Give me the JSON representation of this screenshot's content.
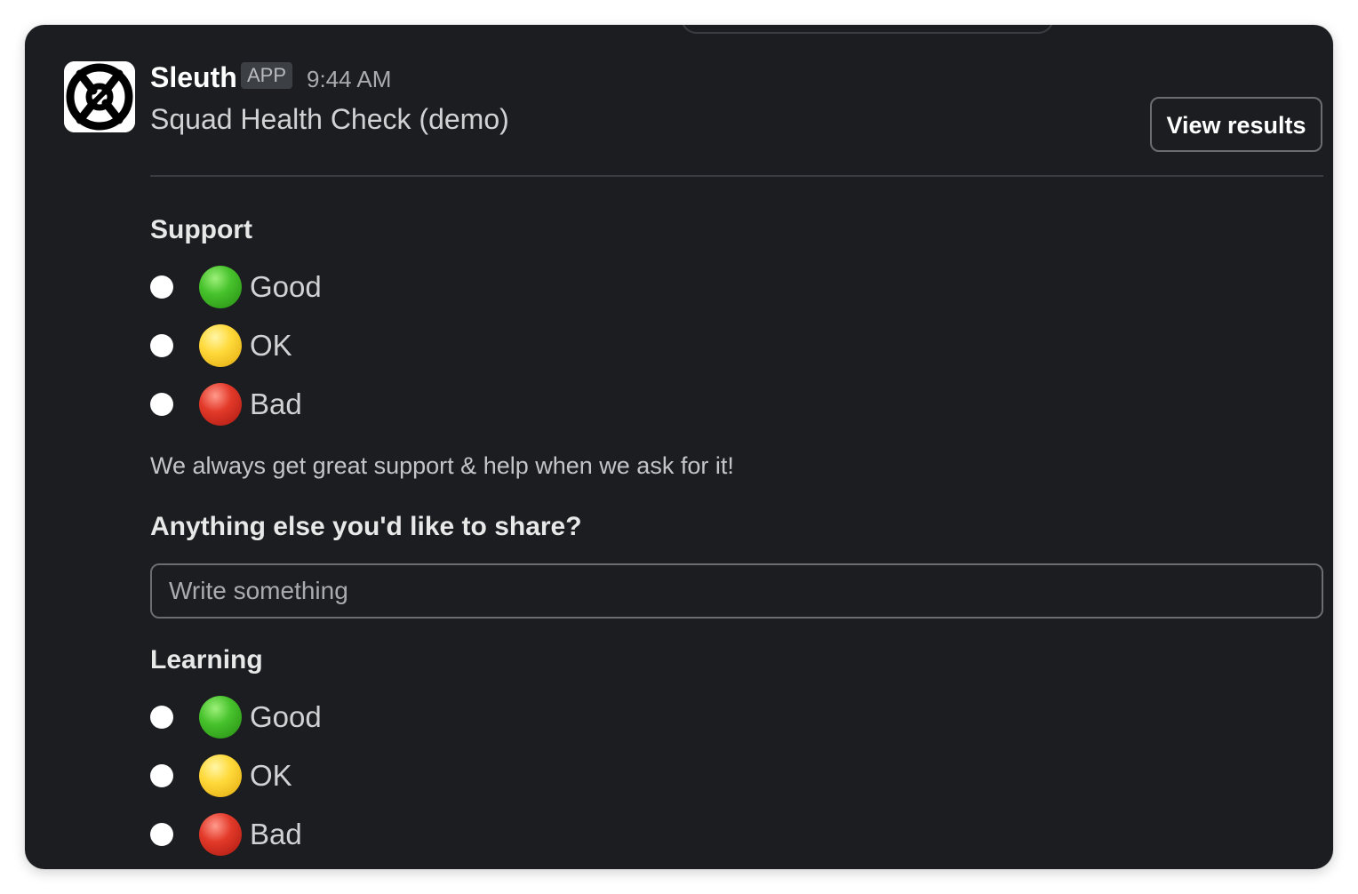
{
  "message": {
    "app_name": "Sleuth",
    "badge": "APP",
    "time": "9:44 AM",
    "title": "Squad Health Check (demo)",
    "view_results_label": "View results"
  },
  "sections": [
    {
      "title": "Support",
      "options": [
        {
          "label": "Good",
          "indicator": "green-circle",
          "color": "#47c22c"
        },
        {
          "label": "OK",
          "indicator": "yellow-circle",
          "color": "#ffd93a"
        },
        {
          "label": "Bad",
          "indicator": "red-circle",
          "color": "#e33a2a"
        }
      ],
      "description": "We always get great support & help when we ask for it!"
    },
    {
      "title": "Learning",
      "options": [
        {
          "label": "Good",
          "indicator": "green-circle",
          "color": "#47c22c"
        },
        {
          "label": "OK",
          "indicator": "yellow-circle",
          "color": "#ffd93a"
        },
        {
          "label": "Bad",
          "indicator": "red-circle",
          "color": "#e33a2a"
        }
      ]
    }
  ],
  "comment": {
    "label": "Anything else you'd like to share?",
    "placeholder": "Write something",
    "value": ""
  },
  "colors": {
    "background": "#1b1d21",
    "text": "#d1d2d3",
    "border": "#6b6d71"
  }
}
